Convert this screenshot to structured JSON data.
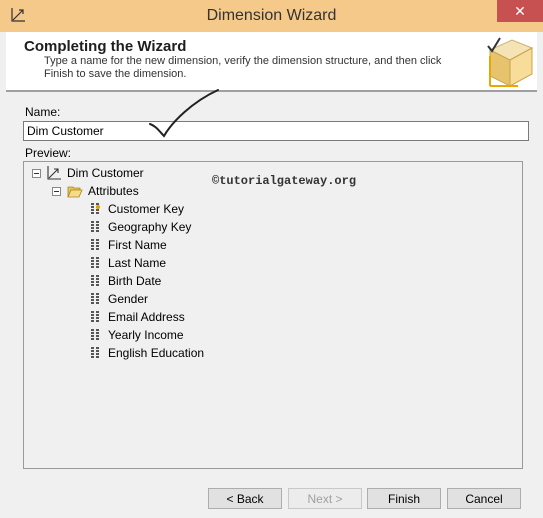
{
  "window": {
    "title": "Dimension Wizard",
    "close_glyph": "✕"
  },
  "header": {
    "title": "Completing the Wizard",
    "description": "Type a name for the new dimension, verify the dimension structure, and then click Finish to save the dimension."
  },
  "name_field": {
    "label": "Name:",
    "value": "Dim Customer"
  },
  "preview": {
    "label": "Preview:",
    "root": "Dim Customer",
    "folder": "Attributes",
    "attributes": [
      {
        "label": "Customer Key",
        "icon": "key-attribute-icon"
      },
      {
        "label": "Geography Key",
        "icon": "attribute-icon"
      },
      {
        "label": "First Name",
        "icon": "attribute-icon"
      },
      {
        "label": "Last Name",
        "icon": "attribute-icon"
      },
      {
        "label": "Birth Date",
        "icon": "attribute-icon"
      },
      {
        "label": "Gender",
        "icon": "attribute-icon"
      },
      {
        "label": "Email Address",
        "icon": "attribute-icon"
      },
      {
        "label": "Yearly Income",
        "icon": "attribute-icon"
      },
      {
        "label": "English Education",
        "icon": "attribute-icon"
      }
    ],
    "watermark": "©tutorialgateway.org"
  },
  "buttons": {
    "back": "< Back",
    "next": "Next >",
    "finish": "Finish",
    "cancel": "Cancel"
  }
}
